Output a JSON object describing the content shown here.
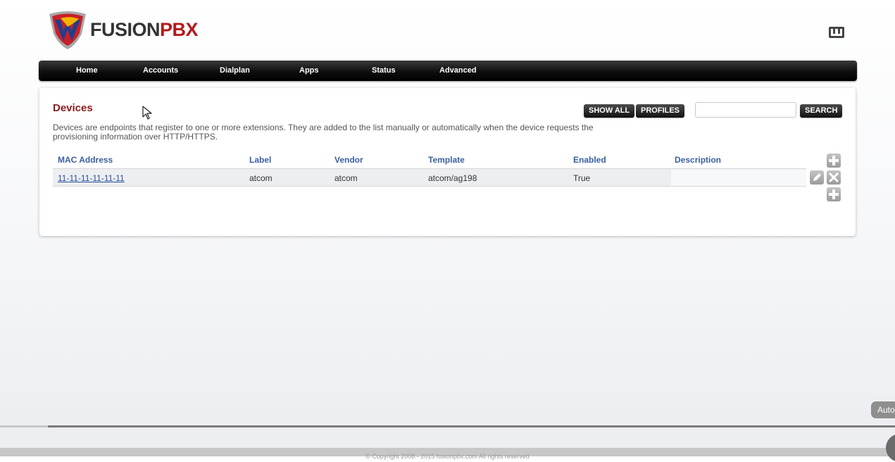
{
  "header": {
    "logo_fusion": "FUSION",
    "logo_pbx": "PBX"
  },
  "menu": {
    "items": [
      "Home",
      "Accounts",
      "Dialplan",
      "Apps",
      "Status",
      "Advanced"
    ]
  },
  "devices": {
    "title": "Devices",
    "description": "Devices are endpoints that register to one or more extensions. They are added to the list manually or automatically when the device requests the provisioning information over HTTP/HTTPS.",
    "show_all_label": "SHOW ALL",
    "profiles_label": "PROFILES",
    "search_label": "SEARCH",
    "search_value": "",
    "columns": [
      "MAC Address",
      "Label",
      "Vendor",
      "Template",
      "Enabled",
      "Description"
    ],
    "rows": [
      {
        "mac": "11-11-11-11-11-11",
        "label": "atcom",
        "vendor": "atcom",
        "template": "atcom/ag198",
        "enabled": "True",
        "description": ""
      }
    ]
  },
  "overlay": {
    "auto_label": "Auto",
    "footer_text": "© Copyright 2008 - 2015 fusionpbx.com All rights reserved"
  },
  "colors": {
    "title": "#8b1c1c",
    "column_header": "#3a5f9e",
    "link": "#2a4f9a",
    "brand_red": "#b51a1a"
  },
  "icons": [
    "logo-shield-icon",
    "logout-icon",
    "add-icon",
    "edit-icon",
    "delete-icon",
    "mouse-cursor-icon"
  ]
}
